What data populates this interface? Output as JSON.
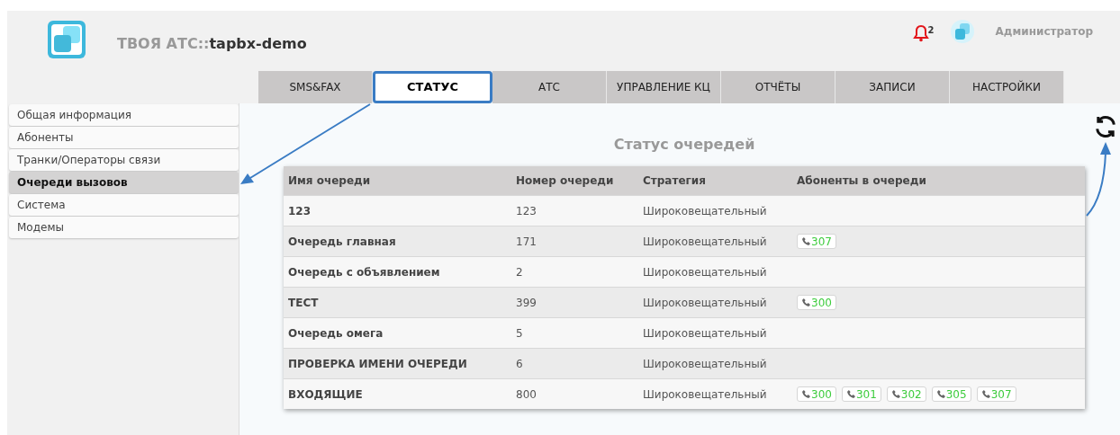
{
  "header": {
    "brand_prefix": "ТВОЯ АТС::",
    "brand_name": "tapbx-demo",
    "notification_count": "2",
    "user": "Администратор"
  },
  "tabs": [
    {
      "label": "SMS&FAX",
      "selected": false
    },
    {
      "label": "СТАТУС",
      "selected": true
    },
    {
      "label": "АТС",
      "selected": false
    },
    {
      "label": "УПРАВЛЕНИЕ КЦ",
      "selected": false
    },
    {
      "label": "ОТЧЁТЫ",
      "selected": false
    },
    {
      "label": "ЗАПИСИ",
      "selected": false
    },
    {
      "label": "НАСТРОЙКИ",
      "selected": false
    }
  ],
  "sidebar": {
    "items": [
      {
        "label": "Общая информация",
        "selected": false
      },
      {
        "label": "Абоненты",
        "selected": false
      },
      {
        "label": "Транки/Операторы связи",
        "selected": false
      },
      {
        "label": "Очереди вызовов",
        "selected": true
      },
      {
        "label": "Система",
        "selected": false
      },
      {
        "label": "Модемы",
        "selected": false
      }
    ]
  },
  "content": {
    "title": "Статус очередей",
    "table": {
      "columns": [
        "Имя очереди",
        "Номер очереди",
        "Стратегия",
        "Абоненты в очереди"
      ],
      "rows": [
        {
          "name": "123",
          "number": "123",
          "strategy": "Широковещательный",
          "subscribers": []
        },
        {
          "name": "Очередь главная",
          "number": "171",
          "strategy": "Широковещательный",
          "subscribers": [
            "307"
          ]
        },
        {
          "name": "Очередь с объявлением",
          "number": "2",
          "strategy": "Широковещательный",
          "subscribers": []
        },
        {
          "name": "ТЕСТ",
          "number": "399",
          "strategy": "Широковещательный",
          "subscribers": [
            "300"
          ]
        },
        {
          "name": "Очередь омега",
          "number": "5",
          "strategy": "Широковещательный",
          "subscribers": []
        },
        {
          "name": "ПРОВЕРКА ИМЕНИ ОЧЕРЕДИ",
          "number": "6",
          "strategy": "Широковещательный",
          "subscribers": []
        },
        {
          "name": "ВХОДЯЩИЕ",
          "number": "800",
          "strategy": "Широковещательный",
          "subscribers": [
            "300",
            "301",
            "302",
            "305",
            "307"
          ]
        }
      ]
    }
  }
}
